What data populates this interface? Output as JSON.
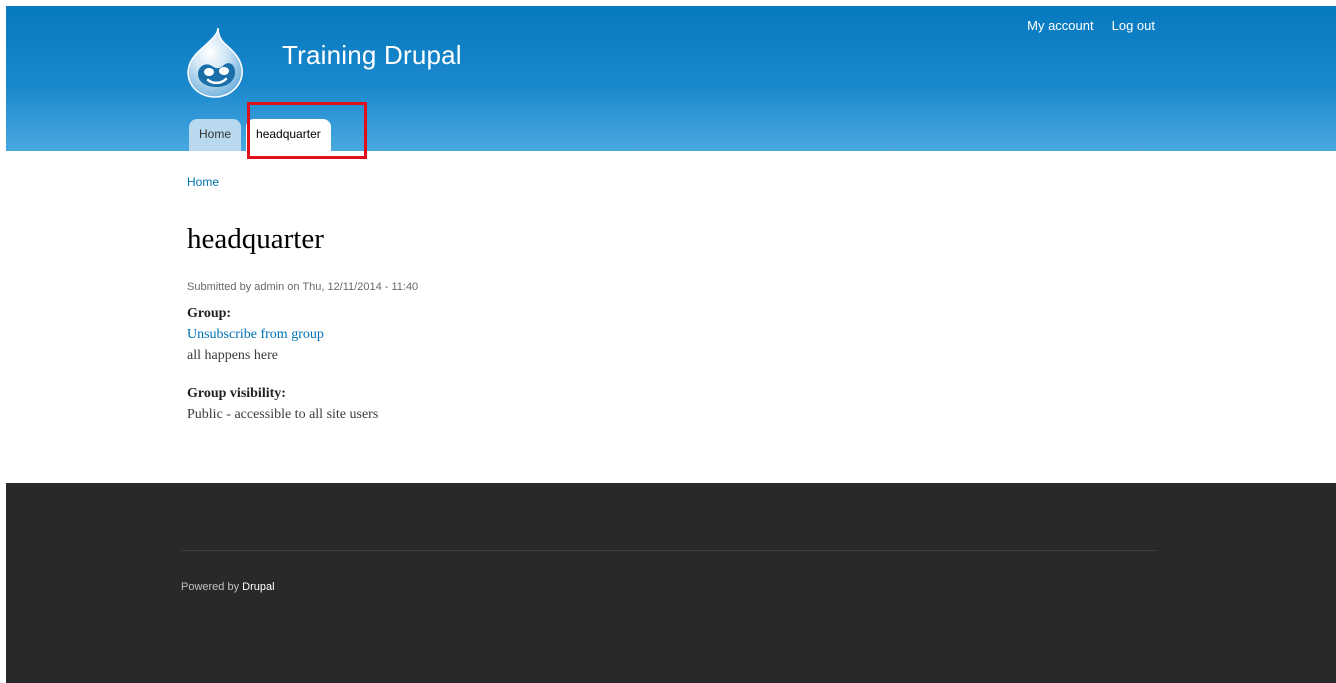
{
  "header": {
    "site_name": "Training Drupal",
    "logo_icon": "drupal-drop-icon",
    "secondary_menu": {
      "my_account": "My account",
      "log_out": "Log out"
    },
    "tabs": [
      {
        "label": "Home"
      },
      {
        "label": "headquarter",
        "active": true
      }
    ]
  },
  "breadcrumb": {
    "home": "Home"
  },
  "node": {
    "title": "headquarter",
    "submitted": {
      "prefix": "Submitted by ",
      "author": "admin",
      "date_text": " on Thu, 12/11/2014 - 11:40"
    },
    "group_label": "Group:",
    "unsubscribe_link": "Unsubscribe from group",
    "group_body": "all happens here",
    "visibility_label": "Group visibility:",
    "visibility_value": "Public - accessible to all site users"
  },
  "footer": {
    "powered_prefix": "Powered by ",
    "powered_link": "Drupal"
  },
  "colors": {
    "header_top": "#0779bf",
    "header_bottom": "#4aa8e0",
    "link": "#0071b3",
    "footer_bg": "#292929",
    "highlight": "#e0101b"
  }
}
